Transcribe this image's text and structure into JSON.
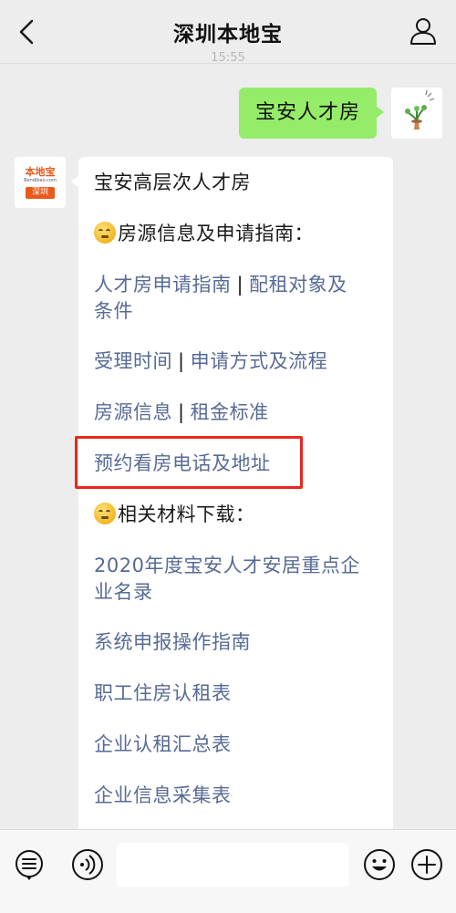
{
  "nav": {
    "title": "深圳本地宝",
    "back_icon": "chevron-left-icon",
    "user_icon": "person-icon"
  },
  "chat": {
    "timestamp": "15:55",
    "outgoing": {
      "text": "宝安人才房"
    },
    "bot_avatar": {
      "logo_text": "本地宝",
      "logo_url": "Bendibao.com",
      "logo_city": "深圳"
    },
    "reply": {
      "title": "宝安高层次人才房",
      "section1": "房源信息及申请指南：",
      "links1": {
        "guide": "人才房申请指南",
        "sep1": "|",
        "target_a": "配租对象及",
        "target_b": "条件",
        "time": "受理时间",
        "sep2": "|",
        "method": "申请方式及流程",
        "info": "房源信息",
        "sep3": "|",
        "rent": "租金标准",
        "appointment": "预约看房电话及地址"
      },
      "section2": "相关材料下载：",
      "links2": {
        "list_a": "2020年度宝安人才安居重点企",
        "list_b": "业名录",
        "system": "系统申报操作指南",
        "staff_form": "职工住房认租表",
        "summary": "企业认租汇总表",
        "company_info": "企业信息采集表"
      }
    }
  },
  "colors": {
    "green_bubble": "#95ec69",
    "link": "#576b95",
    "highlight": "#e8281e",
    "logo_orange": "#e8591a"
  }
}
